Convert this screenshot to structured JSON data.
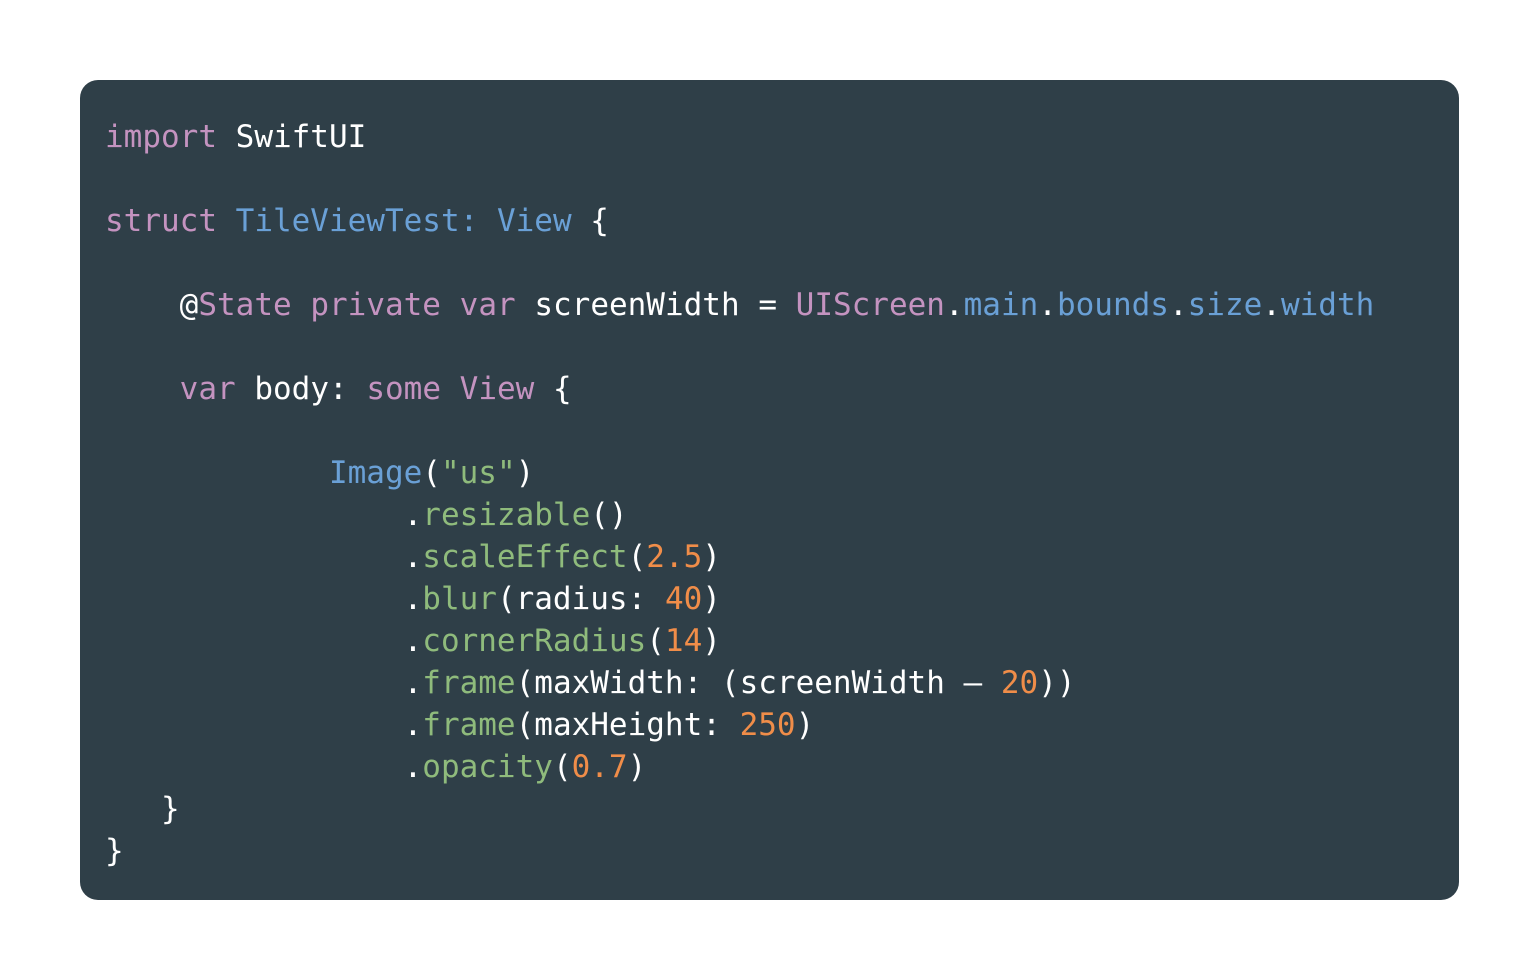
{
  "code": {
    "l1_kw": "import",
    "l1_mod": "SwiftUI",
    "l3_kw": "struct",
    "l3_name": "TileViewTest:",
    "l3_type": "View",
    "l3_brace": "{",
    "l5_at": "@",
    "l5_attr": "State",
    "l5_kw1": "private",
    "l5_kw2": "var",
    "l5_var": "screenWidth",
    "l5_eq": "=",
    "l5_cls": "UIScreen",
    "l5_p1": "main",
    "l5_p2": "bounds",
    "l5_p3": "size",
    "l5_p4": "width",
    "l7_kw": "var",
    "l7_name": "body:",
    "l7_some": "some",
    "l7_type": "View",
    "l7_brace": "{",
    "l9_type": "Image",
    "l9_str": "\"us\"",
    "l10_fn": "resizable",
    "l11_fn": "scaleEffect",
    "l11_num": "2.5",
    "l12_fn": "blur",
    "l12_arg": "radius:",
    "l12_num": "40",
    "l13_fn": "cornerRadius",
    "l13_num": "14",
    "l14_fn": "frame",
    "l14_arg": "maxWidth: (screenWidth –",
    "l14_num": "20",
    "l15_fn": "frame",
    "l15_arg": "maxHeight:",
    "l15_num": "250",
    "l16_fn": "opacity",
    "l16_num": "0.7",
    "l17_brace": "}",
    "l18_brace": "}"
  },
  "colors": {
    "background": "#ffffff",
    "card": "#2f3f48",
    "keyword": "#c493c0",
    "type": "#6aa0d6",
    "function": "#8fbb7c",
    "number": "#f08d49",
    "plain": "#ffffff"
  }
}
